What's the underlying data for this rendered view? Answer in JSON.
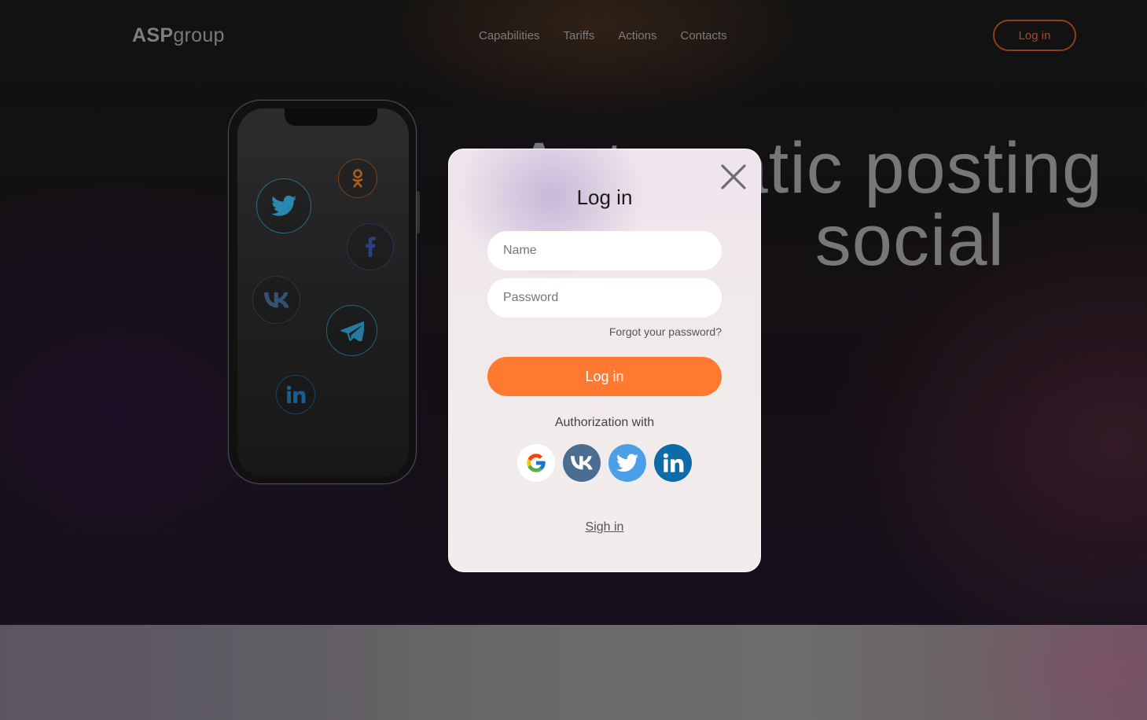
{
  "header": {
    "logo_bold": "ASP",
    "logo_light": "group",
    "nav": [
      "Capabilities",
      "Tariffs",
      "Actions",
      "Contacts"
    ],
    "login_label": "Log in"
  },
  "hero": {
    "title_line1": "Automatic posting",
    "title_line2": "social"
  },
  "phone": {
    "icons": [
      "twitter-icon",
      "odnoklassniki-icon",
      "facebook-icon",
      "vk-icon",
      "telegram-icon",
      "linkedin-icon"
    ]
  },
  "modal": {
    "title": "Log in",
    "name_placeholder": "Name",
    "password_placeholder": "Password",
    "forgot_label": "Forgot your password?",
    "submit_label": "Log in",
    "auth_with_label": "Authorization with",
    "providers": [
      "google-icon",
      "vk-icon",
      "twitter-icon",
      "linkedin-icon"
    ],
    "signin_label": "Sigh in"
  },
  "colors": {
    "accent": "#ff7a30",
    "vk": "#4c6c91",
    "twitter": "#4a9fe8",
    "linkedin": "#0d6ba8"
  }
}
